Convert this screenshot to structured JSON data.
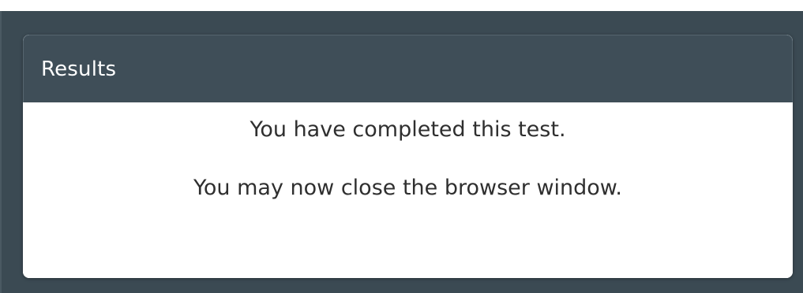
{
  "results_panel": {
    "title": "Results",
    "messages": [
      "You have completed this test.",
      "You may now close the browser window."
    ]
  },
  "colors": {
    "backdrop": "#3b4a53",
    "header": "#3f4e58",
    "panel_body": "#ffffff",
    "title_text": "#ffffff",
    "message_text": "#2f2f2f"
  }
}
